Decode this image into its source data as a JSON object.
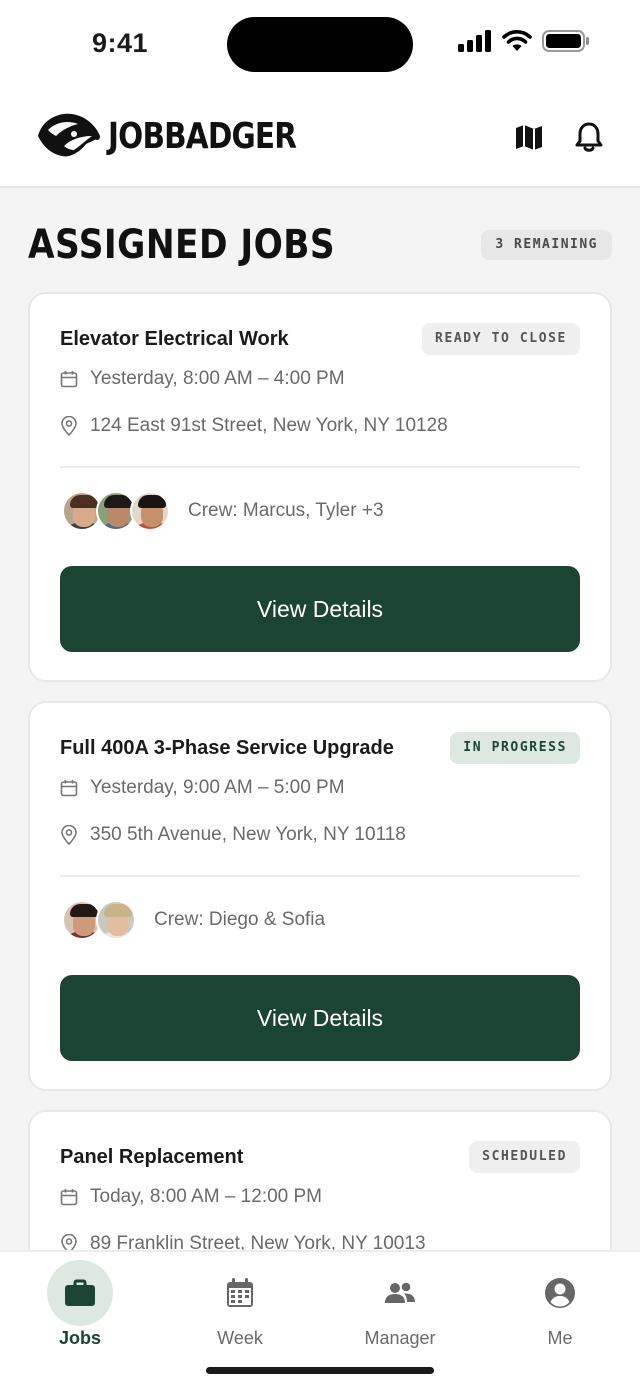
{
  "status_bar": {
    "time": "9:41"
  },
  "header": {
    "brand": "JOBBADGER",
    "map_icon": "map-icon",
    "bell_icon": "bell-icon"
  },
  "section": {
    "title": "ASSIGNED JOBS",
    "remaining": "3 REMAINING"
  },
  "jobs": [
    {
      "title": "Elevator Electrical Work",
      "status": "READY TO CLOSE",
      "time": "Yesterday, 8:00 AM – 4:00 PM",
      "address": "124 East 91st Street, New York, NY 10128",
      "crew": "Crew: Marcus, Tyler +3",
      "button": "View Details"
    },
    {
      "title": "Full 400A 3-Phase Service Upgrade",
      "status": "IN PROGRESS",
      "time": "Yesterday, 9:00 AM – 5:00 PM",
      "address": "350 5th Avenue, New York, NY 10118",
      "crew": "Crew: Diego & Sofia",
      "button": "View Details"
    },
    {
      "title": "Panel Replacement",
      "status": "SCHEDULED",
      "time": "Today, 8:00 AM – 12:00 PM",
      "address": "89 Franklin Street, New York, NY 10013"
    }
  ],
  "tabs": [
    {
      "label": "Jobs",
      "icon": "briefcase-icon",
      "active": true
    },
    {
      "label": "Week",
      "icon": "calendar-icon"
    },
    {
      "label": "Manager",
      "icon": "people-icon"
    },
    {
      "label": "Me",
      "icon": "person-icon"
    }
  ],
  "colors": {
    "primary": "#1c4433",
    "badge_green": "#dde9e0",
    "background": "#f3f4f3"
  }
}
